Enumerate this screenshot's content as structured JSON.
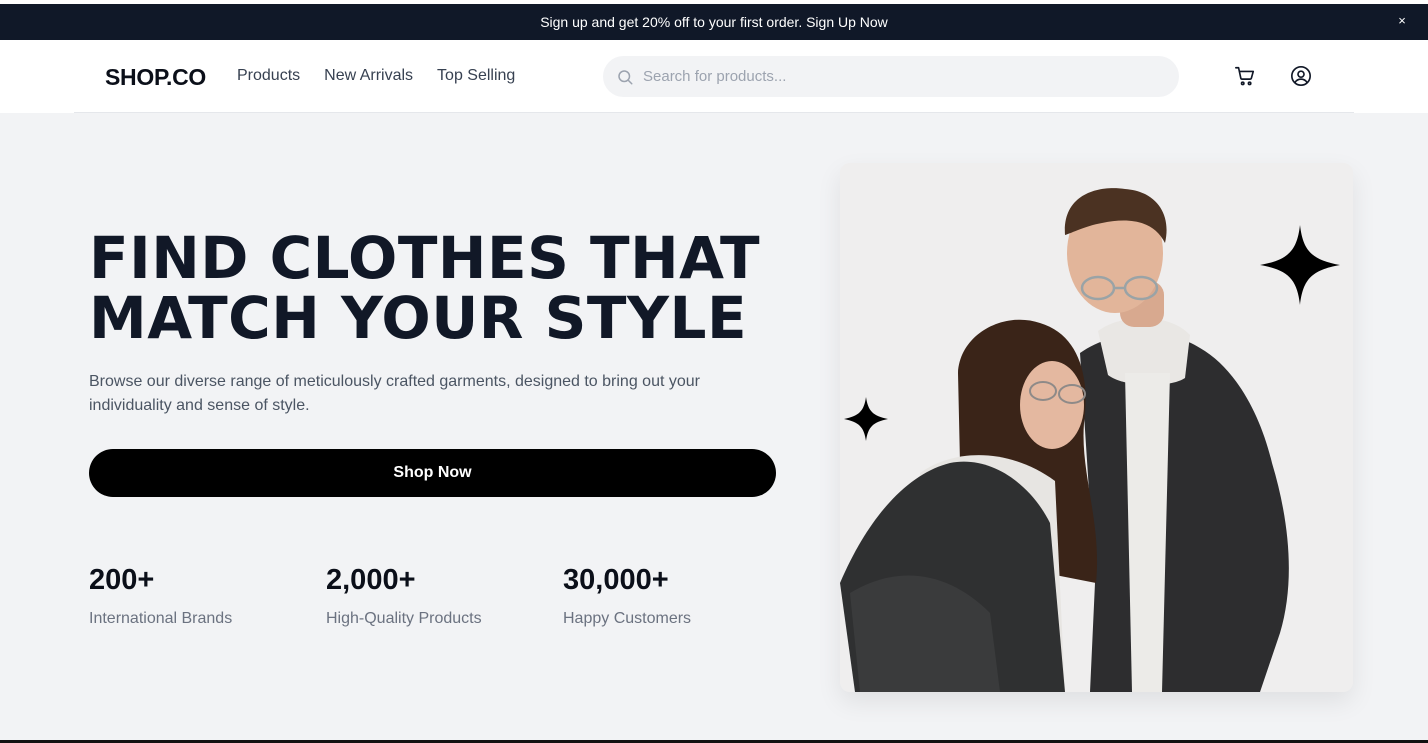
{
  "promo": {
    "text": "Sign up and get 20% off to your first order. Sign Up Now",
    "close_label": "×"
  },
  "navbar": {
    "logo": "SHOP.CO",
    "links": [
      "Products",
      "New Arrivals",
      "Top Selling"
    ],
    "search_placeholder": "Search for products...",
    "icons": [
      "search-icon",
      "cart-icon",
      "user-icon"
    ]
  },
  "hero": {
    "headline_line1": "FIND CLOTHES THAT",
    "headline_line2": "MATCH YOUR STYLE",
    "description": "Browse our diverse range of meticulously crafted garments, designed to bring out your individuality and sense of style.",
    "cta_label": "Shop Now",
    "stats": [
      {
        "value": "200+",
        "label": "International Brands"
      },
      {
        "value": "2,000+",
        "label": "High-Quality Products"
      },
      {
        "value": "30,000+",
        "label": "Happy Customers"
      }
    ],
    "image_icons": [
      "sparkle-star-icon",
      "sparkle-star-icon"
    ]
  },
  "colors": {
    "promo_bg": "#101828",
    "page_bg": "#f2f3f5",
    "text_dark": "#111827",
    "button_bg": "#000000"
  }
}
